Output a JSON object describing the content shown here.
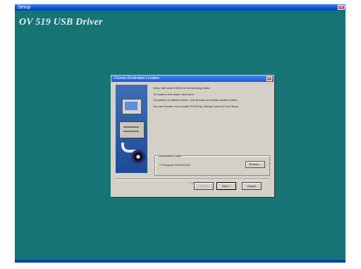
{
  "window": {
    "title": "Setup",
    "close_glyph": "×",
    "banner": "OV 519 USB Driver"
  },
  "dialog": {
    "title": "Choose Destination Location",
    "close_glyph": "×",
    "message": [
      "Setup will install OV519 in the following folder.",
      "To install to this folder, click Next.",
      "To install to a different folder, click Browse and select another folder.",
      "You can choose not to install OV519 by clicking Cancel to exit Setup."
    ],
    "destination": {
      "label": "Destination Folder",
      "path": "C:\\Program Files\\OV519",
      "browse": "Browse..."
    },
    "installshield": "InstallShield",
    "buttons": {
      "back": "< Back",
      "next": "Next >",
      "cancel": "Cancel"
    }
  },
  "colors": {
    "desktop_teal": "#167574",
    "titlebar_blue": "#0a52d8",
    "dialog_face": "#d4d0c8"
  }
}
